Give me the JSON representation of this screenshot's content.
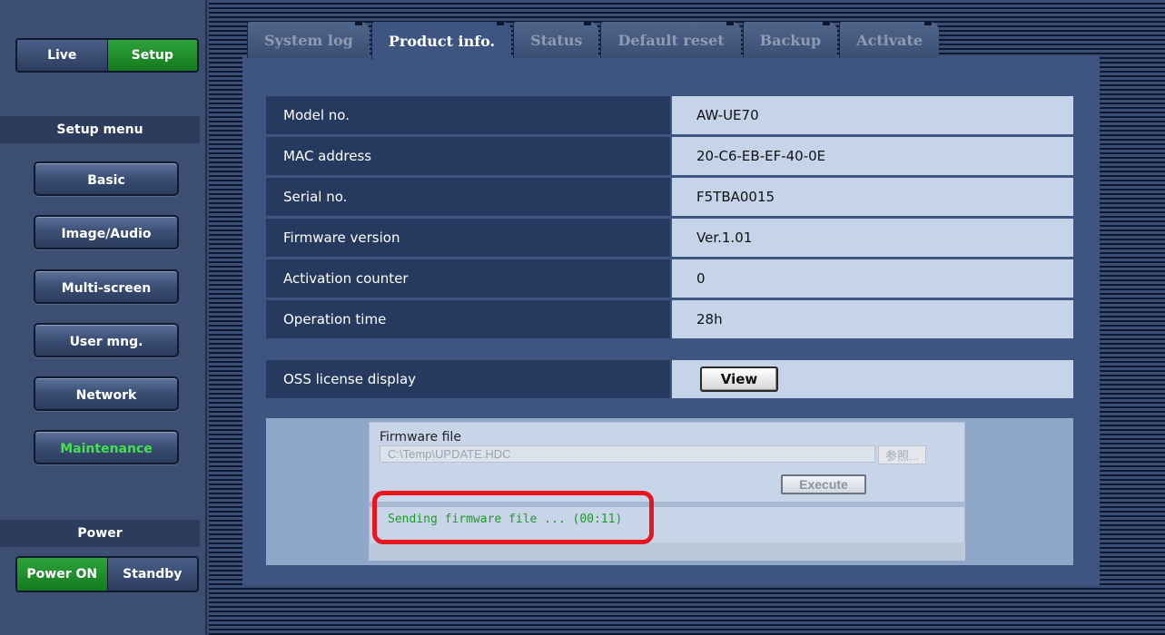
{
  "mode_toggle": {
    "live": "Live",
    "setup": "Setup"
  },
  "setup_menu": {
    "header": "Setup menu",
    "items": [
      {
        "label": "Basic"
      },
      {
        "label": "Image/Audio"
      },
      {
        "label": "Multi-screen"
      },
      {
        "label": "User mng."
      },
      {
        "label": "Network"
      },
      {
        "label": "Maintenance"
      }
    ]
  },
  "power": {
    "header": "Power",
    "on": "Power ON",
    "standby": "Standby"
  },
  "tabs": [
    {
      "label": "System log"
    },
    {
      "label": "Product info."
    },
    {
      "label": "Status"
    },
    {
      "label": "Default reset"
    },
    {
      "label": "Backup"
    },
    {
      "label": "Activate"
    }
  ],
  "product_info": {
    "rows": [
      {
        "label": "Model no.",
        "value": "AW-UE70"
      },
      {
        "label": "MAC address",
        "value": "20-C6-EB-EF-40-0E"
      },
      {
        "label": "Serial no.",
        "value": "F5TBA0015"
      },
      {
        "label": "Firmware version",
        "value": "Ver.1.01"
      },
      {
        "label": "Activation counter",
        "value": "0"
      },
      {
        "label": "Operation time",
        "value": "28h"
      }
    ],
    "oss_label": "OSS license display",
    "view_button": "View"
  },
  "firmware": {
    "label": "Firmware file",
    "path": "C:\\Temp\\UPDATE.HDC",
    "browse_button": "参照...",
    "execute_button": "Execute",
    "status": "Sending firmware file ... (00:11)"
  },
  "colors": {
    "active_green": "#1e8a28",
    "maintenance_text": "#44e04e",
    "highlight_red": "#e8141e",
    "status_green": "#1e9a2a"
  }
}
